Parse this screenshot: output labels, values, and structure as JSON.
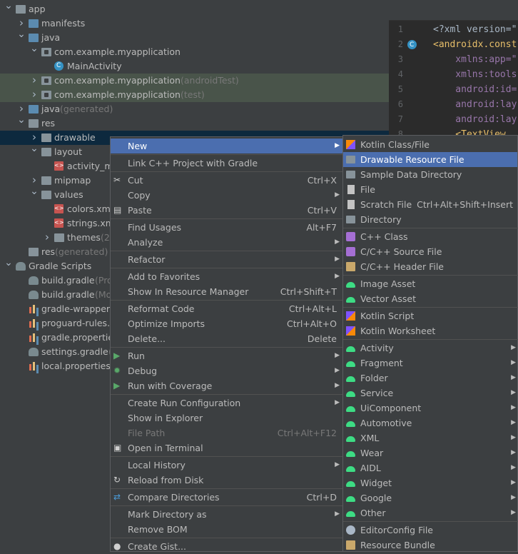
{
  "tree": [
    {
      "label": "app",
      "suffix": "",
      "indent": 0,
      "arrow": "v",
      "icon": "folder"
    },
    {
      "label": "manifests",
      "suffix": "",
      "indent": 1,
      "arrow": ">",
      "icon": "folder-blue"
    },
    {
      "label": "java",
      "suffix": "",
      "indent": 1,
      "arrow": "v",
      "icon": "folder-blue"
    },
    {
      "label": "com.example.myapplication",
      "suffix": "",
      "indent": 2,
      "arrow": "v",
      "icon": "package"
    },
    {
      "label": "MainActivity",
      "suffix": "",
      "indent": 3,
      "arrow": "",
      "icon": "class"
    },
    {
      "label": "com.example.myapplication",
      "suffix": " (androidTest)",
      "indent": 2,
      "arrow": ">",
      "icon": "package",
      "tint": true
    },
    {
      "label": "com.example.myapplication",
      "suffix": " (test)",
      "indent": 2,
      "arrow": ">",
      "icon": "package",
      "tint": true
    },
    {
      "label": "java",
      "suffix": " (generated)",
      "indent": 1,
      "arrow": ">",
      "icon": "folder-blue"
    },
    {
      "label": "res",
      "suffix": "",
      "indent": 1,
      "arrow": "v",
      "icon": "folder"
    },
    {
      "label": "drawable",
      "suffix": "",
      "indent": 2,
      "arrow": ">",
      "icon": "folder",
      "selected": true
    },
    {
      "label": "layout",
      "suffix": "",
      "indent": 2,
      "arrow": "v",
      "icon": "folder"
    },
    {
      "label": "activity_ma",
      "suffix": "",
      "indent": 3,
      "arrow": "",
      "icon": "xml"
    },
    {
      "label": "mipmap",
      "suffix": "",
      "indent": 2,
      "arrow": ">",
      "icon": "folder"
    },
    {
      "label": "values",
      "suffix": "",
      "indent": 2,
      "arrow": "v",
      "icon": "folder"
    },
    {
      "label": "colors.xml",
      "suffix": "",
      "indent": 3,
      "arrow": "",
      "icon": "xml"
    },
    {
      "label": "strings.xml",
      "suffix": "",
      "indent": 3,
      "arrow": "",
      "icon": "xml"
    },
    {
      "label": "themes",
      "suffix": " (2)",
      "indent": 3,
      "arrow": ">",
      "icon": "folder"
    },
    {
      "label": "res",
      "suffix": " (generated)",
      "indent": 1,
      "arrow": "",
      "icon": "folder"
    },
    {
      "label": "Gradle Scripts",
      "suffix": "",
      "indent": 0,
      "arrow": "v",
      "icon": "gradle"
    },
    {
      "label": "build.gradle",
      "suffix": " (Proj",
      "indent": 1,
      "arrow": "",
      "icon": "gradle"
    },
    {
      "label": "build.gradle",
      "suffix": " (Mo",
      "indent": 1,
      "arrow": "",
      "icon": "gradle"
    },
    {
      "label": "gradle-wrapper.p",
      "suffix": "",
      "indent": 1,
      "arrow": "",
      "icon": "chart"
    },
    {
      "label": "proguard-rules.p",
      "suffix": "",
      "indent": 1,
      "arrow": "",
      "icon": "chart"
    },
    {
      "label": "gradle.properties",
      "suffix": "",
      "indent": 1,
      "arrow": "",
      "icon": "chart"
    },
    {
      "label": "settings.gradle",
      "suffix": " (P",
      "indent": 1,
      "arrow": "",
      "icon": "gradle"
    },
    {
      "label": "local.properties",
      "suffix": " (",
      "indent": 1,
      "arrow": "",
      "icon": "chart"
    }
  ],
  "editor": {
    "lines": [
      {
        "num": "1",
        "parts": [
          {
            "t": "<?xml version=\"",
            "c": "txt"
          }
        ]
      },
      {
        "num": "2",
        "parts": [
          {
            "t": "<androidx.const",
            "c": "tag"
          }
        ],
        "gutter": true
      },
      {
        "num": "3",
        "parts": [
          {
            "t": "    xmlns:app=\"",
            "c": "attr"
          }
        ]
      },
      {
        "num": "4",
        "parts": [
          {
            "t": "    xmlns:tools",
            "c": "attr"
          }
        ]
      },
      {
        "num": "5",
        "parts": [
          {
            "t": "    android:id=",
            "c": "attr"
          }
        ]
      },
      {
        "num": "6",
        "parts": [
          {
            "t": "    android:lay",
            "c": "attr"
          }
        ]
      },
      {
        "num": "7",
        "parts": [
          {
            "t": "    android:lay",
            "c": "attr"
          }
        ]
      },
      {
        "num": "8",
        "parts": [
          {
            "t": "    <TextView",
            "c": "tag"
          }
        ]
      }
    ]
  },
  "context_menu": [
    {
      "label": "New",
      "shortcut": "",
      "submenu": true,
      "highlighted": true,
      "icon": ""
    },
    {
      "sep": true
    },
    {
      "label": "Link C++ Project with Gradle",
      "shortcut": "",
      "icon": ""
    },
    {
      "sep": true
    },
    {
      "label": "Cut",
      "shortcut": "Ctrl+X",
      "icon": "scissors-icon"
    },
    {
      "label": "Copy",
      "shortcut": "",
      "submenu": true,
      "icon": ""
    },
    {
      "label": "Paste",
      "shortcut": "Ctrl+V",
      "icon": "paste-icon"
    },
    {
      "sep": true
    },
    {
      "label": "Find Usages",
      "shortcut": "Alt+F7",
      "icon": ""
    },
    {
      "label": "Analyze",
      "shortcut": "",
      "submenu": true,
      "icon": ""
    },
    {
      "sep": true
    },
    {
      "label": "Refactor",
      "shortcut": "",
      "submenu": true,
      "icon": ""
    },
    {
      "sep": true
    },
    {
      "label": "Add to Favorites",
      "shortcut": "",
      "submenu": true,
      "icon": ""
    },
    {
      "label": "Show In Resource Manager",
      "shortcut": "Ctrl+Shift+T",
      "icon": ""
    },
    {
      "sep": true
    },
    {
      "label": "Reformat Code",
      "shortcut": "Ctrl+Alt+L",
      "icon": ""
    },
    {
      "label": "Optimize Imports",
      "shortcut": "Ctrl+Alt+O",
      "icon": ""
    },
    {
      "label": "Delete...",
      "shortcut": "Delete",
      "icon": ""
    },
    {
      "sep": true
    },
    {
      "label": "Run",
      "shortcut": "",
      "submenu": true,
      "icon": "run-icon"
    },
    {
      "label": "Debug",
      "shortcut": "",
      "submenu": true,
      "icon": "debug-icon"
    },
    {
      "label": "Run with Coverage",
      "shortcut": "",
      "submenu": true,
      "icon": "coverage-icon"
    },
    {
      "sep": true
    },
    {
      "label": "Create Run Configuration",
      "shortcut": "",
      "submenu": true,
      "icon": ""
    },
    {
      "label": "Show in Explorer",
      "shortcut": "",
      "icon": ""
    },
    {
      "label": "File Path",
      "shortcut": "Ctrl+Alt+F12",
      "disabled": true,
      "icon": ""
    },
    {
      "label": "Open in Terminal",
      "shortcut": "",
      "icon": "terminal-icon"
    },
    {
      "sep": true
    },
    {
      "label": "Local History",
      "shortcut": "",
      "submenu": true,
      "icon": ""
    },
    {
      "label": "Reload from Disk",
      "shortcut": "",
      "icon": "reload-icon"
    },
    {
      "sep": true
    },
    {
      "label": "Compare Directories",
      "shortcut": "Ctrl+D",
      "icon": "compare-icon"
    },
    {
      "sep": true
    },
    {
      "label": "Mark Directory as",
      "shortcut": "",
      "submenu": true,
      "icon": ""
    },
    {
      "label": "Remove BOM",
      "shortcut": "",
      "icon": ""
    },
    {
      "sep": true
    },
    {
      "label": "Create Gist...",
      "shortcut": "",
      "icon": "github-icon"
    }
  ],
  "new_submenu": [
    {
      "label": "Kotlin Class/File",
      "shortcut": "",
      "icon": "kotlin-icon"
    },
    {
      "label": "Drawable Resource File",
      "shortcut": "",
      "icon": "drawable-icon",
      "highlighted": true
    },
    {
      "label": "Sample Data Directory",
      "shortcut": "",
      "icon": "folder-icon"
    },
    {
      "label": "File",
      "shortcut": "",
      "icon": "file-icon"
    },
    {
      "label": "Scratch File",
      "shortcut": "Ctrl+Alt+Shift+Insert",
      "icon": "scratch-icon"
    },
    {
      "label": "Directory",
      "shortcut": "",
      "icon": "folder-icon"
    },
    {
      "sep": true
    },
    {
      "label": "C++ Class",
      "shortcut": "",
      "icon": "cpp-class-icon"
    },
    {
      "label": "C/C++ Source File",
      "shortcut": "",
      "icon": "cpp-source-icon"
    },
    {
      "label": "C/C++ Header File",
      "shortcut": "",
      "icon": "cpp-header-icon"
    },
    {
      "sep": true
    },
    {
      "label": "Image Asset",
      "shortcut": "",
      "icon": "android-icon"
    },
    {
      "label": "Vector Asset",
      "shortcut": "",
      "icon": "android-icon"
    },
    {
      "sep": true
    },
    {
      "label": "Kotlin Script",
      "shortcut": "",
      "icon": "kotlin-script-icon"
    },
    {
      "label": "Kotlin Worksheet",
      "shortcut": "",
      "icon": "kotlin-script-icon"
    },
    {
      "sep": true
    },
    {
      "label": "Activity",
      "shortcut": "",
      "submenu": true,
      "icon": "android-icon"
    },
    {
      "label": "Fragment",
      "shortcut": "",
      "submenu": true,
      "icon": "android-icon"
    },
    {
      "label": "Folder",
      "shortcut": "",
      "submenu": true,
      "icon": "android-icon"
    },
    {
      "label": "Service",
      "shortcut": "",
      "submenu": true,
      "icon": "android-icon"
    },
    {
      "label": "UiComponent",
      "shortcut": "",
      "submenu": true,
      "icon": "android-icon"
    },
    {
      "label": "Automotive",
      "shortcut": "",
      "submenu": true,
      "icon": "android-icon"
    },
    {
      "label": "XML",
      "shortcut": "",
      "submenu": true,
      "icon": "android-icon"
    },
    {
      "label": "Wear",
      "shortcut": "",
      "submenu": true,
      "icon": "android-icon"
    },
    {
      "label": "AIDL",
      "shortcut": "",
      "submenu": true,
      "icon": "android-icon"
    },
    {
      "label": "Widget",
      "shortcut": "",
      "submenu": true,
      "icon": "android-icon"
    },
    {
      "label": "Google",
      "shortcut": "",
      "submenu": true,
      "icon": "android-icon"
    },
    {
      "label": "Other",
      "shortcut": "",
      "submenu": true,
      "icon": "android-icon"
    },
    {
      "sep": true
    },
    {
      "label": "EditorConfig File",
      "shortcut": "",
      "icon": "gear-icon"
    },
    {
      "label": "Resource Bundle",
      "shortcut": "",
      "icon": "bundle-icon"
    }
  ],
  "colors": {
    "highlight": "#4b6eaf",
    "menu_bg": "#3c3f41",
    "selection": "#0d293e",
    "android_green": "#3ddc84"
  }
}
